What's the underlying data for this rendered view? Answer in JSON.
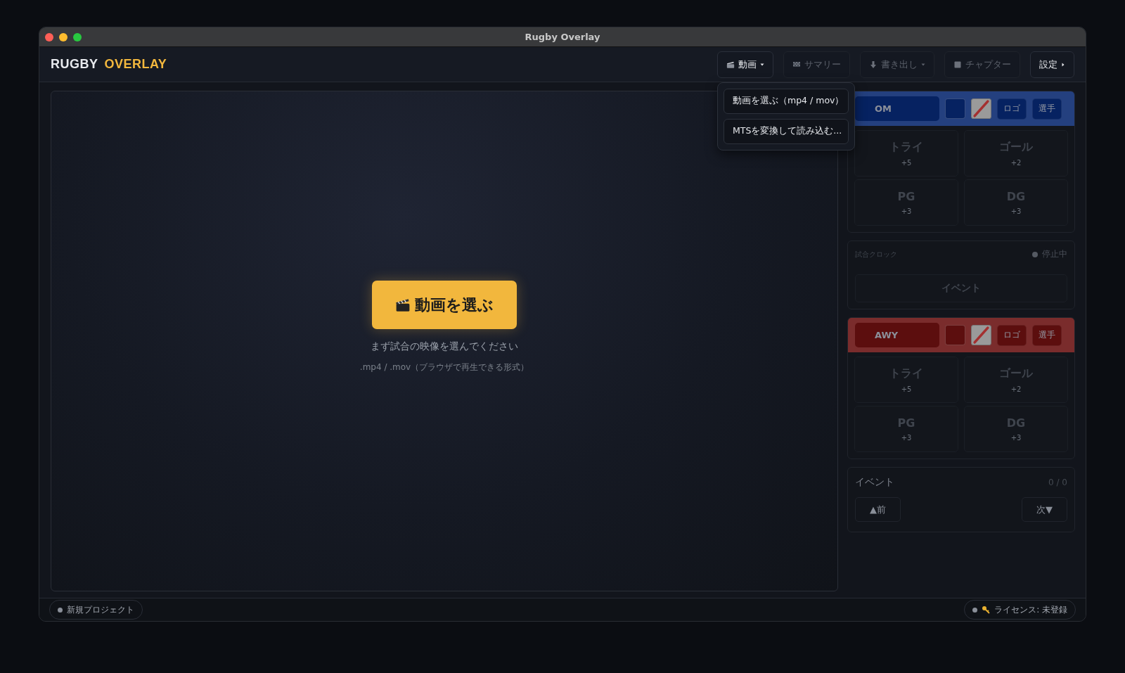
{
  "window": {
    "title": "Rugby Overlay"
  },
  "logo": {
    "first": "RUGBY",
    "second": "OVERLAY"
  },
  "toolbar": [
    {
      "label": "動画",
      "kind": "video",
      "disabled": false
    },
    {
      "label": "サマリー",
      "kind": "summary",
      "disabled": true
    },
    {
      "label": "書き出し",
      "kind": "export",
      "disabled": true
    },
    {
      "label": "チャプター",
      "kind": "chapter",
      "disabled": true
    },
    {
      "label": "設定",
      "kind": "settings",
      "disabled": false
    }
  ],
  "video_menu": [
    {
      "label": "動画を選ぶ（mp4 / mov）"
    },
    {
      "label": "MTSを変換して読み込む..."
    }
  ],
  "video_placeholder": {
    "button": "動画を選ぶ",
    "hint": "まず試合の映像を選んでください",
    "formats": ".mp4 / .mov（ブラウザで再生できる形式）"
  },
  "teams": [
    {
      "name": "OM",
      "color": "#24407f",
      "logo_button": "ロゴ",
      "players_button": "選手",
      "scores": [
        {
          "label": "トライ",
          "points": "+5"
        },
        {
          "label": "ゴール",
          "points": "+2"
        },
        {
          "label": "PG",
          "points": "+3"
        },
        {
          "label": "DG",
          "points": "+3"
        }
      ]
    },
    {
      "name": "AWY",
      "color": "#7a2c2c",
      "logo_button": "ロゴ",
      "players_button": "選手",
      "scores": [
        {
          "label": "トライ",
          "points": "+5"
        },
        {
          "label": "ゴール",
          "points": "+2"
        },
        {
          "label": "PG",
          "points": "+3"
        },
        {
          "label": "DG",
          "points": "+3"
        }
      ]
    }
  ],
  "clock": {
    "label": "試合クロック",
    "status": "停止中",
    "running": false,
    "event_button": "イベント"
  },
  "events": {
    "title": "イベント",
    "count": "0 / 0",
    "prev": "▲前",
    "next": "次▼"
  },
  "status_bar": {
    "project": "新規プロジェクト",
    "license": "ライセンス: 未登録"
  }
}
